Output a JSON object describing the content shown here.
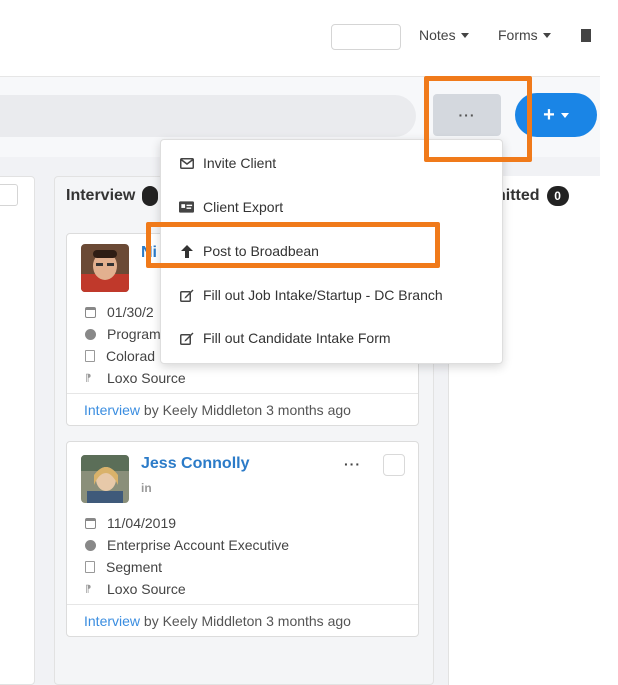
{
  "topnav": {
    "notes_label": "Notes",
    "forms_label": "Forms"
  },
  "toolbar": {
    "more_label": "···",
    "add_label": "+"
  },
  "columns": [
    {
      "title": "Interview",
      "count": ""
    },
    {
      "title": "nitted",
      "count": "0"
    }
  ],
  "menu": {
    "items": [
      {
        "label": "Invite Client",
        "icon": "envelope-icon"
      },
      {
        "label": "Client Export",
        "icon": "id-card-icon"
      },
      {
        "label": "Post to Broadbean",
        "icon": "arrow-up-icon"
      },
      {
        "label": "Fill out Job Intake/Startup - DC Branch",
        "icon": "edit-icon"
      },
      {
        "label": "Fill out Candidate Intake Form",
        "icon": "edit-icon"
      }
    ]
  },
  "cards": [
    {
      "name": "Ni",
      "date": "01/30/2",
      "title": "Program",
      "location": "Colorad",
      "source": "Loxo Source",
      "footer_link": "Interview",
      "footer_text": " by Keely Middleton 3 months ago"
    },
    {
      "name": "Jess Connolly",
      "linkedin": "in",
      "menu_label": "···",
      "date": "11/04/2019",
      "title": "Enterprise Account Executive",
      "location": "Segment",
      "source": "Loxo Source",
      "footer_link": "Interview",
      "footer_text": " by Keely Middleton 3 months ago"
    }
  ],
  "colors": {
    "accent_blue": "#1a85e6",
    "highlight_orange": "#f07a1a",
    "link_blue": "#2b7bc8"
  }
}
